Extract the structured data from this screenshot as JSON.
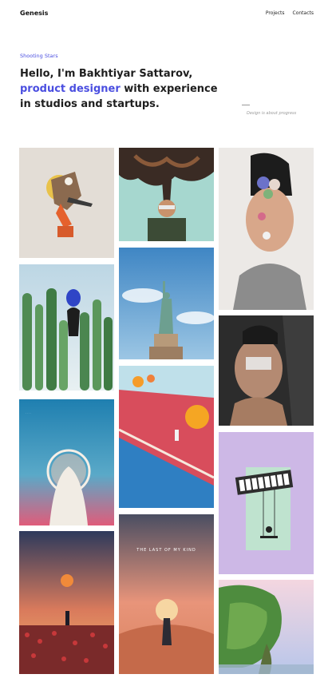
{
  "header": {
    "logo": "Genesis",
    "nav": [
      "Projects",
      "Contacts"
    ]
  },
  "hero": {
    "eyebrow": "Shooting Stars",
    "headline_before": "Hello, I'm Bakhtiyar Sattarov,",
    "headline_accent": "product designer",
    "headline_after": "with experience in studios and startups.",
    "tagline": "Design is about progress"
  },
  "gallery": {
    "tiles": [
      {
        "name": "collage-figure-artwork",
        "caption": ""
      },
      {
        "name": "floating-hair-portrait-artwork",
        "caption": ""
      },
      {
        "name": "flowers-face-portrait-artwork",
        "caption": ""
      },
      {
        "name": "cactus-balloon-artwork",
        "caption": ""
      },
      {
        "name": "statue-of-liberty-artwork",
        "caption": ""
      },
      {
        "name": "cracked-face-portrait-artwork",
        "caption": ""
      },
      {
        "name": "veiled-figure-artwork",
        "caption": ""
      },
      {
        "name": "red-track-spheres-artwork",
        "caption": ""
      },
      {
        "name": "piano-swing-artwork",
        "caption": ""
      },
      {
        "name": "sunset-field-artwork",
        "caption": ""
      },
      {
        "name": "desert-woman-artwork",
        "caption": "THE LAST OF MY KIND"
      },
      {
        "name": "floating-island-artwork",
        "caption": ""
      }
    ]
  }
}
